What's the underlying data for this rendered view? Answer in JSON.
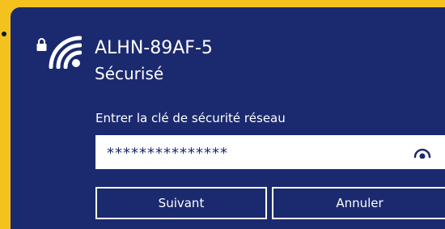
{
  "network": {
    "ssid": "ALHN-89AF-5",
    "status": "Sécurisé"
  },
  "key": {
    "label": "Entrer la clé de sécurité réseau",
    "value": "***************"
  },
  "buttons": {
    "next": "Suivant",
    "cancel": "Annuler"
  },
  "colors": {
    "background": "#f4c21e",
    "panel": "#1b2a6f",
    "text": "#ffffff"
  },
  "icons": [
    "lock-icon",
    "wifi-icon",
    "reveal-password-icon"
  ]
}
